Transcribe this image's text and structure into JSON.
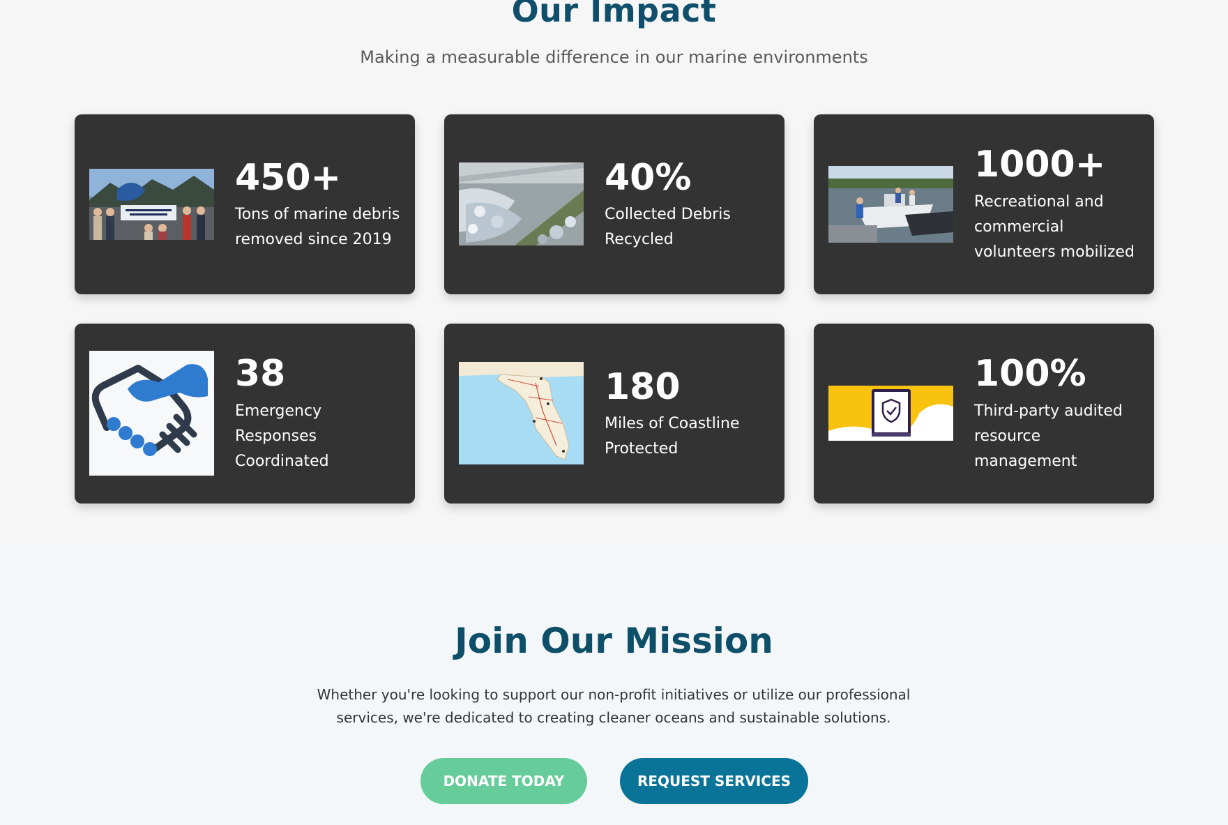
{
  "impact": {
    "title": "Our Impact",
    "subtitle": "Making a measurable difference in our marine environments",
    "cards": [
      {
        "value": "450+",
        "label": "Tons of marine debris removed since 2019",
        "image": "volunteer-group-photo"
      },
      {
        "value": "40%",
        "label": "Collected Debris Recycled",
        "image": "recycling-facility-photo"
      },
      {
        "value": "1000+",
        "label": "Recreational and commercial volunteers mobilized",
        "image": "boats-at-dock-photo"
      },
      {
        "value": "38",
        "label": "Emergency Responses Coordinated",
        "image": "handshake-icon"
      },
      {
        "value": "180",
        "label": "Miles of Coastline Protected",
        "image": "florida-map"
      },
      {
        "value": "100%",
        "label": "Third-party audited resource management",
        "image": "audit-badge-icon"
      }
    ]
  },
  "mission": {
    "title": "Join Our Mission",
    "text": "Whether you're looking to support our non-profit initiatives or utilize our professional services, we're dedicated to creating cleaner oceans and sustainable solutions.",
    "donate_label": "DONATE TODAY",
    "request_label": "REQUEST SERVICES"
  },
  "colors": {
    "heading": "#0f4f6b",
    "card_bg": "#333333",
    "donate": "#66cc99",
    "request": "#0a7398"
  }
}
